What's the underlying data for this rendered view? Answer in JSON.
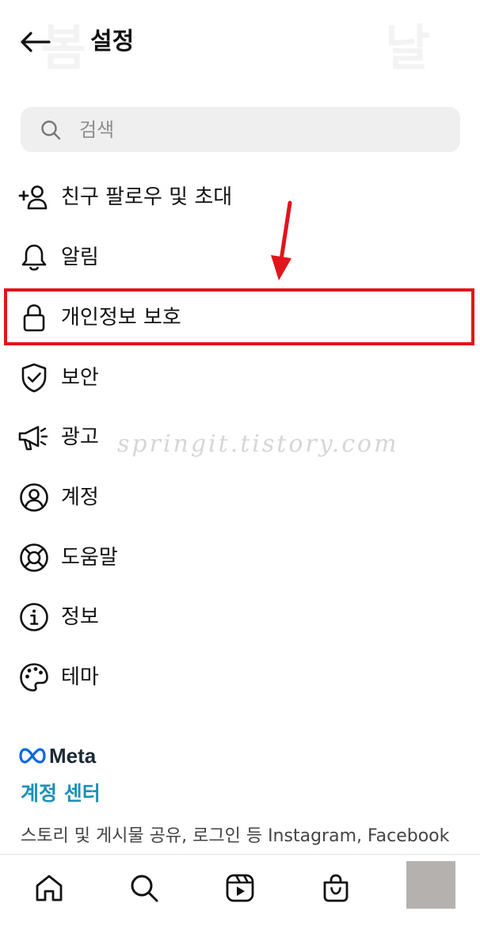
{
  "header": {
    "title": "설정",
    "back_icon": "arrow-left-icon"
  },
  "background_ghost_text": [
    "봄",
    "날"
  ],
  "search": {
    "placeholder": "검색",
    "value": "",
    "icon": "search-icon"
  },
  "menu": [
    {
      "label": "친구 팔로우 및 초대",
      "icon": "add-person-icon"
    },
    {
      "label": "알림",
      "icon": "bell-icon"
    },
    {
      "label": "개인정보 보호",
      "icon": "lock-icon",
      "highlighted": true
    },
    {
      "label": "보안",
      "icon": "shield-check-icon"
    },
    {
      "label": "광고",
      "icon": "megaphone-icon"
    },
    {
      "label": "계정",
      "icon": "account-circle-icon"
    },
    {
      "label": "도움말",
      "icon": "lifebuoy-icon"
    },
    {
      "label": "정보",
      "icon": "info-icon"
    },
    {
      "label": "테마",
      "icon": "palette-icon"
    }
  ],
  "watermark": "springit.tistory.com",
  "meta_section": {
    "logo_text": "Meta",
    "account_center_label": "계정 센터",
    "description": "스토리 및 게시물 공유, 로그인 등 Instagram, Facebook"
  },
  "bottom_nav": [
    "home-icon",
    "search-icon",
    "reels-icon",
    "shop-icon",
    "profile-avatar"
  ],
  "colors": {
    "highlight_border": "#e0141b",
    "account_center": "#1e8fb8",
    "search_bg": "#efefef"
  }
}
